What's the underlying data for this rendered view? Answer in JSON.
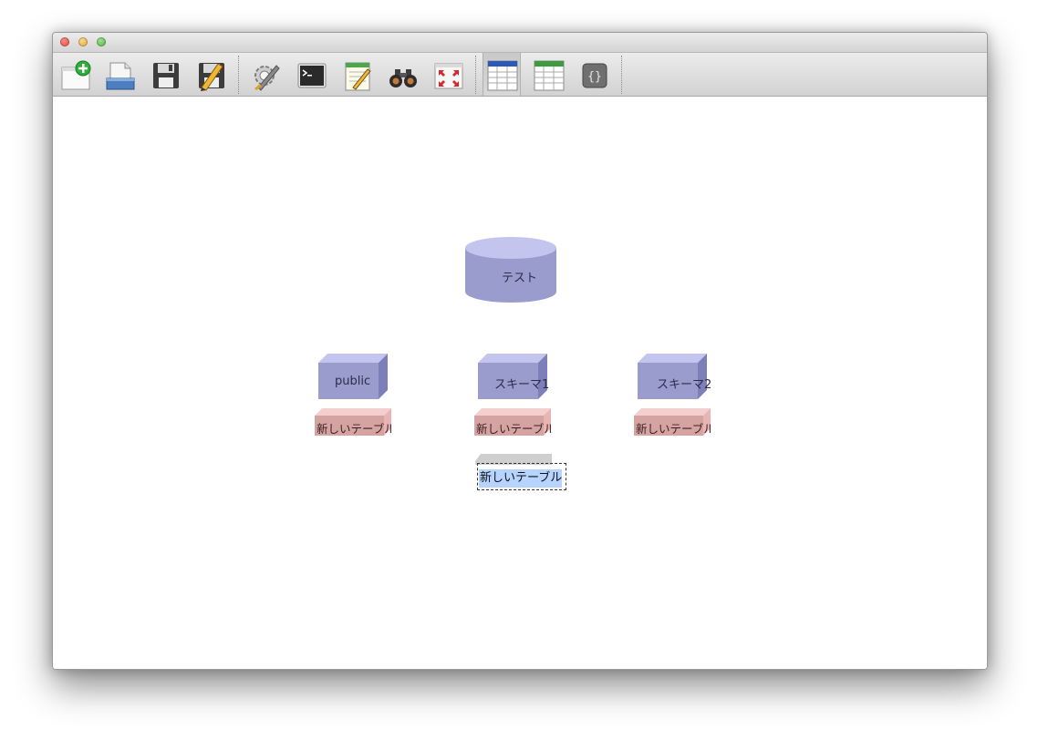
{
  "window": {
    "controls": [
      "close",
      "minimize",
      "maximize"
    ]
  },
  "toolbar": {
    "buttons": [
      {
        "icon": "new-document-icon"
      },
      {
        "icon": "open-file-icon"
      },
      {
        "icon": "save-icon"
      },
      {
        "icon": "save-as-icon"
      },
      {
        "icon": "settings-icon"
      },
      {
        "icon": "terminal-icon"
      },
      {
        "icon": "notepad-icon"
      },
      {
        "icon": "binoculars-icon"
      },
      {
        "icon": "fit-screen-icon"
      },
      {
        "icon": "table-blue-icon",
        "selected": true
      },
      {
        "icon": "table-green-icon"
      },
      {
        "icon": "braces-icon"
      }
    ]
  },
  "diagram": {
    "database": {
      "label": "テスト",
      "color": "#9a9ccd"
    },
    "schemas": [
      {
        "label": "public"
      },
      {
        "label": "スキーマ1"
      },
      {
        "label": "スキーマ2"
      }
    ],
    "tables": [
      {
        "label": "新しいテーブル"
      },
      {
        "label": "新しいテーブル"
      },
      {
        "label": "新しいテーブル"
      }
    ],
    "editing_table": {
      "value": "新しいテーブル"
    },
    "colors": {
      "schema": "#9a9ccd",
      "schema_top": "#c4c5ee",
      "table": "#d6a3a3",
      "table_top": "#f4cfcf",
      "selection": "#b7d3ff"
    }
  }
}
